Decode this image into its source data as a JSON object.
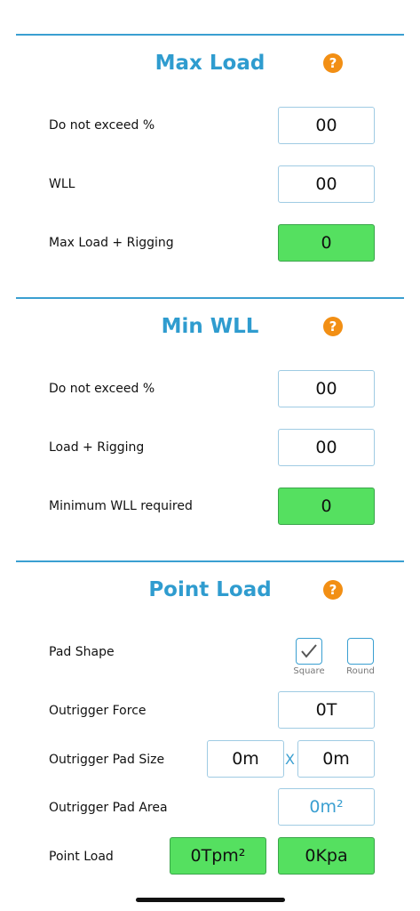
{
  "max_load": {
    "title": "Max Load",
    "help": "?",
    "rows": [
      {
        "label": "Do not exceed %",
        "value": "00"
      },
      {
        "label": "WLL",
        "value": "00"
      },
      {
        "label": "Max Load + Rigging",
        "value": "0"
      }
    ]
  },
  "min_wll": {
    "title": "Min WLL",
    "help": "?",
    "rows": [
      {
        "label": "Do not exceed %",
        "value": "00"
      },
      {
        "label": "Load + Rigging",
        "value": "00"
      },
      {
        "label": "Minimum WLL required",
        "value": "0"
      }
    ]
  },
  "point_load": {
    "title": "Point Load",
    "help": "?",
    "pad_shape": {
      "label": "Pad Shape",
      "options": [
        {
          "label": "Square",
          "checked": true
        },
        {
          "label": "Round",
          "checked": false
        }
      ]
    },
    "outrigger_force": {
      "label": "Outrigger Force",
      "value": "0T"
    },
    "outrigger_pad_size": {
      "label": "Outrigger Pad Size",
      "width": "0m",
      "separator": "X",
      "length": "0m"
    },
    "outrigger_pad_area": {
      "label": "Outrigger Pad Area",
      "value": "0m²"
    },
    "point_load": {
      "label": "Point Load",
      "tpm": "0Tpm²",
      "kpa": "0Kpa"
    }
  },
  "colors": {
    "accent": "#2f9ccf",
    "help": "#f28f14",
    "result": "#55e060"
  }
}
